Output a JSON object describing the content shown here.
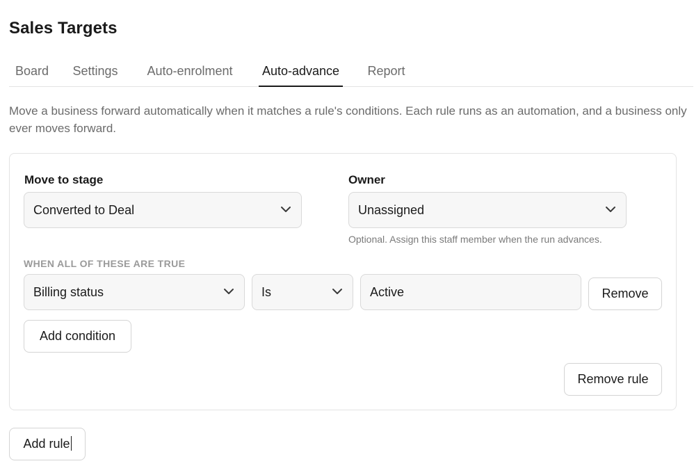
{
  "page": {
    "title": "Sales Targets"
  },
  "tabs": [
    {
      "label": "Board",
      "active": false
    },
    {
      "label": "Settings",
      "active": false
    },
    {
      "label": "Auto-enrolment",
      "active": false
    },
    {
      "label": "Auto-advance",
      "active": true
    },
    {
      "label": "Report",
      "active": false
    }
  ],
  "description": "Move a business forward automatically when it matches a rule's conditions. Each rule runs as an automation, and a business only ever moves forward.",
  "rule": {
    "move_to_stage": {
      "label": "Move to stage",
      "value": "Converted to Deal"
    },
    "owner": {
      "label": "Owner",
      "value": "Unassigned",
      "helper": "Optional. Assign this staff member when the run advances."
    },
    "conditions_label": "WHEN ALL OF THESE ARE TRUE",
    "conditions": [
      {
        "field": "Billing status",
        "operator": "Is",
        "value": "Active",
        "remove_label": "Remove"
      }
    ],
    "add_condition_label": "Add condition",
    "remove_rule_label": "Remove rule"
  },
  "add_rule_label": "Add rule",
  "icons": {
    "dropdown": "chevron-down-icon"
  }
}
